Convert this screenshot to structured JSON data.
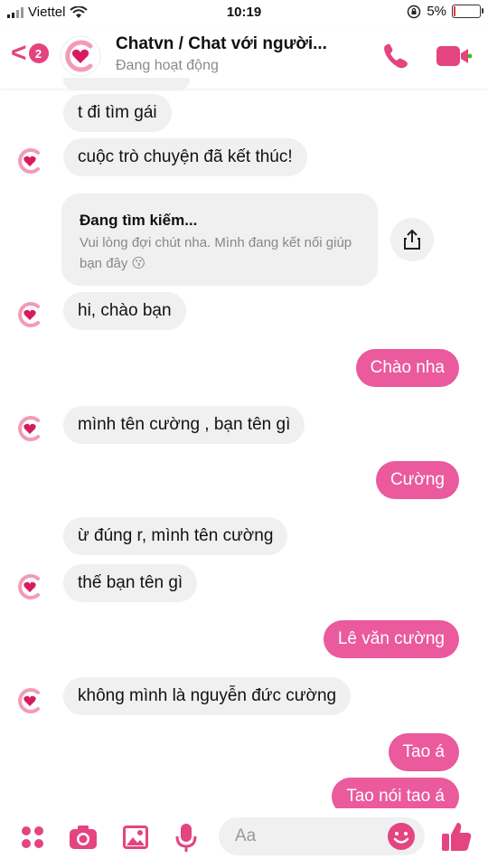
{
  "status_bar": {
    "carrier": "Viettel",
    "time": "10:19",
    "battery": "5%"
  },
  "header": {
    "back_badge": "2",
    "title": "Chatvn / Chat với người...",
    "subtitle": "Đang hoạt động",
    "accent": "#e4447f"
  },
  "messages": [
    {
      "side": "in",
      "text": "t đi tìm gái"
    },
    {
      "side": "in",
      "text": "cuộc trò chuyện đã kết thúc!"
    },
    {
      "side": "card",
      "title": "Đang tìm kiếm...",
      "text": "Vui lòng đợi chút nha. Mình đang kết nối giúp bạn đây 😗"
    },
    {
      "side": "in",
      "text": "hi, chào bạn"
    },
    {
      "side": "out",
      "text": "Chào nha"
    },
    {
      "side": "in",
      "text": "mình tên cường , bạn tên gì"
    },
    {
      "side": "out",
      "text": "Cường"
    },
    {
      "side": "in",
      "text": "ừ đúng r, mình tên cường"
    },
    {
      "side": "in",
      "text": "thế bạn tên gì"
    },
    {
      "side": "out",
      "text": "Lê văn cường"
    },
    {
      "side": "in",
      "text": "không mình là nguyễn đức cường"
    },
    {
      "side": "out",
      "text": "Tao á"
    },
    {
      "side": "out",
      "text": "Tao nói tao á"
    }
  ],
  "composer": {
    "placeholder": "Aa"
  },
  "colors": {
    "outgoing_bubble": "#ea5a9d",
    "incoming_bubble": "#f0f0f0",
    "icon_pink": "#e4447f"
  },
  "icons": [
    "signal-icon",
    "wifi-icon",
    "rotation-lock-icon",
    "battery-icon",
    "back-chevron-icon",
    "chatvn-logo-icon",
    "phone-icon",
    "video-camera-icon",
    "share-icon",
    "apps-menu-icon",
    "camera-icon",
    "image-icon",
    "microphone-icon",
    "emoji-icon",
    "thumbs-up-icon"
  ]
}
